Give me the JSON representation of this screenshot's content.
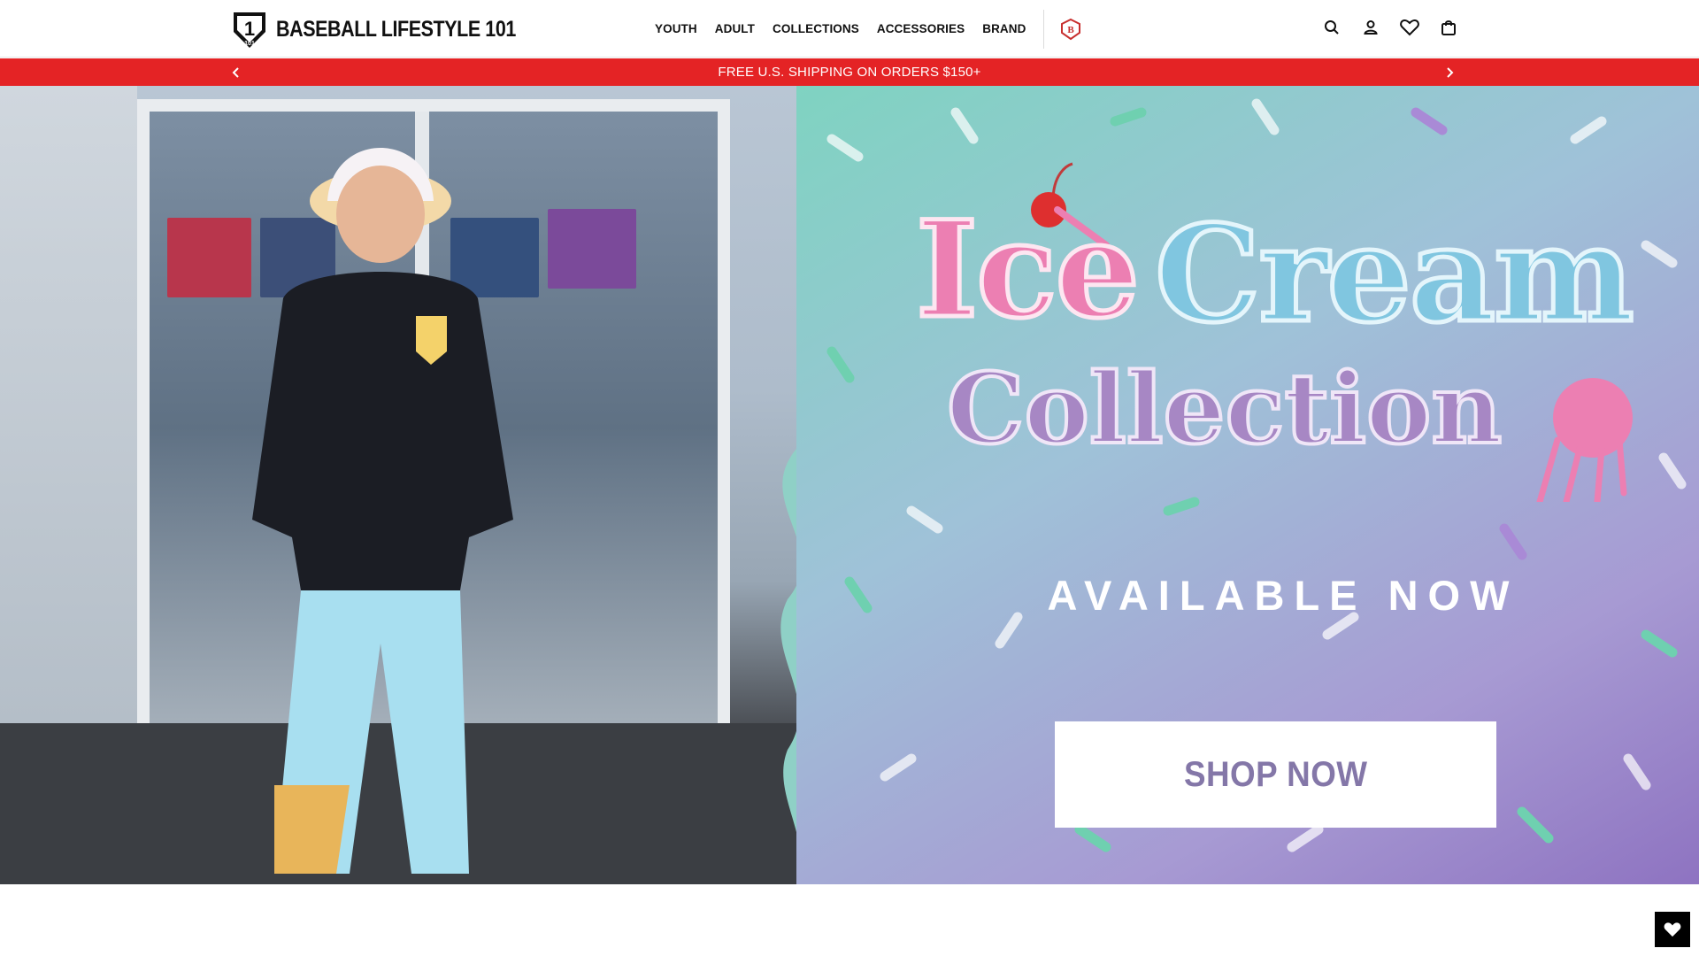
{
  "header": {
    "logo_text": "BASEBALL LIFESTYLE 101",
    "nav": [
      {
        "label": "YOUTH"
      },
      {
        "label": "ADULT"
      },
      {
        "label": "COLLECTIONS"
      },
      {
        "label": "ACCESSORIES"
      },
      {
        "label": "BRAND"
      }
    ],
    "icons": [
      "search-icon",
      "account-icon",
      "wishlist-heart-icon",
      "cart-bag-icon"
    ]
  },
  "announcement": {
    "text": "FREE U.S. SHIPPING ON ORDERS $150+",
    "background": "#e42325"
  },
  "hero": {
    "title_line1a": "Ice",
    "title_line1b": "Cream",
    "title_line2": "Collection",
    "subtitle": "AVAILABLE NOW",
    "cta_label": "SHOP NOW",
    "colors": {
      "pink": "#ec7fb2",
      "blue": "#80c6e0",
      "purple": "#a787c4",
      "cta_text": "#8477a8"
    }
  },
  "floating": {
    "wishlist_icon": "heart-icon"
  }
}
